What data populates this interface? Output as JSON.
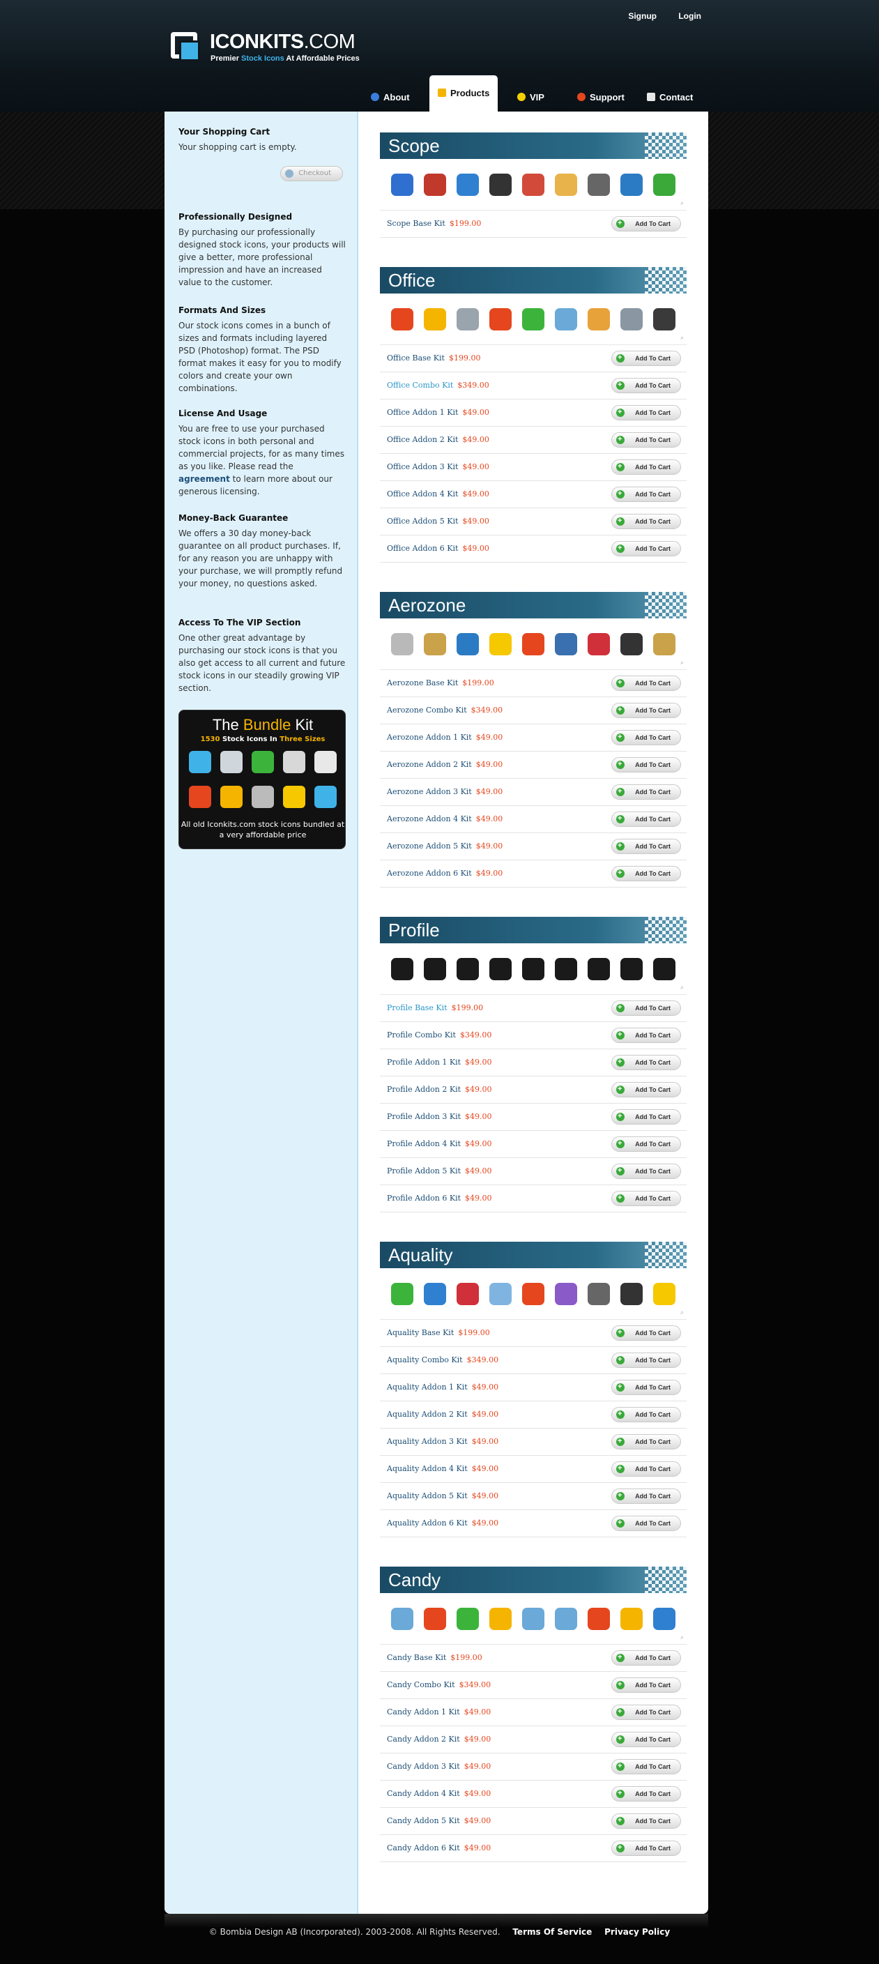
{
  "header": {
    "logo_bold": "ICONKITS",
    "logo_suffix": ".COM",
    "tagline_a": "Premier ",
    "tagline_b": "Stock Icons",
    "tagline_c": " At Affordable Prices",
    "signup": "Signup",
    "login": "Login"
  },
  "nav": [
    {
      "label": "About",
      "icon": "info-icon",
      "color": "#3b7ddd"
    },
    {
      "label": "Products",
      "icon": "box-icon",
      "color": "#f5b400"
    },
    {
      "label": "VIP",
      "icon": "lightbulb-icon",
      "color": "#f5d000"
    },
    {
      "label": "Support",
      "icon": "lifebuoy-icon",
      "color": "#e5461e"
    },
    {
      "label": "Contact",
      "icon": "mail-icon",
      "color": "#e8e8e8"
    }
  ],
  "sidebar": {
    "cart_title": "Your Shopping Cart",
    "cart_text": "Your shopping cart is empty.",
    "checkout": "Checkout",
    "blocks": [
      {
        "title": "Professionally Designed",
        "text": "By purchasing our professionally designed stock icons, your products will give a better, more professional impression and have an increased value to the customer."
      },
      {
        "title": "Formats And Sizes",
        "text": "Our stock icons comes in a bunch of sizes and formats including layered PSD (Photoshop) format. The PSD format makes it easy for you to modify colors and create your own combinations."
      },
      {
        "title": "License And Usage",
        "text_a": "You are free to use your purchased stock icons in both personal and commercial projects, for as many times as you like. Please read the ",
        "link": "agreement",
        "text_b": " to learn more about our generous licensing."
      },
      {
        "title": "Money-Back Guarantee",
        "text": "We offers a 30 day money-back guarantee on all product purchases. If, for any reason you are unhappy with your purchase, we will promptly refund your money, no questions asked."
      },
      {
        "title": "Access To The VIP Section",
        "text": "One other great advantage by purchasing our stock icons is that you also get access to all current and future stock icons in our steadily growing VIP section."
      }
    ],
    "bundle": {
      "title_a": "The ",
      "title_b": "Bundle",
      "title_c": " Kit",
      "sub_a": "1530",
      "sub_b": " Stock Icons In ",
      "sub_c": "Three Sizes",
      "foot": "All old Iconkits.com stock icons bundled at a very affordable price",
      "icons": [
        "refresh-icon",
        "calculator-icon",
        "arrow-left-icon",
        "document-icon",
        "card-icon",
        "forbidden-icon",
        "folder-icon",
        "contrast-icon",
        "grid-icon",
        "music-note-icon"
      ],
      "icon_colors": [
        "#3fb3e8",
        "#cfd6dc",
        "#3cb43c",
        "#d8d8d8",
        "#e8e8e8",
        "#e5461e",
        "#f5b400",
        "#bbbbbb",
        "#f5c800",
        "#3fb3e8"
      ]
    }
  },
  "add_label": "Add To Cart",
  "sections": [
    {
      "title": "Scope",
      "icons": [
        "info-icon",
        "user-icon",
        "refresh-icon",
        "floppy-disk-icon",
        "clock-icon",
        "envelope-icon",
        "magnifier-icon",
        "globe-icon",
        "arrow-redo-icon"
      ],
      "icon_colors": [
        "#2f6fd0",
        "#c0392b",
        "#2f80d0",
        "#333333",
        "#d24b3a",
        "#e8b34a",
        "#666666",
        "#2b7bc4",
        "#3aa93a"
      ],
      "kits": [
        {
          "name": "Scope Base Kit",
          "price": "$199.00"
        }
      ]
    },
    {
      "title": "Office",
      "icons": [
        "close-icon",
        "envelope-icon",
        "calculator-icon",
        "stop-icon",
        "arrow-left-icon",
        "folder-icon",
        "user-icon",
        "calendar-icon",
        "floppy-disk-icon"
      ],
      "icon_colors": [
        "#e5461e",
        "#f5b400",
        "#9aa4ad",
        "#e5461e",
        "#3cb43c",
        "#6aa9d8",
        "#e8a23a",
        "#8a97a3",
        "#3a3a3a"
      ],
      "kits": [
        {
          "name": "Office Base Kit",
          "price": "$199.00"
        },
        {
          "name": "Office Combo Kit",
          "price": "$349.00",
          "light": true
        },
        {
          "name": "Office Addon 1 Kit",
          "price": "$49.00"
        },
        {
          "name": "Office Addon 2 Kit",
          "price": "$49.00"
        },
        {
          "name": "Office Addon 3 Kit",
          "price": "$49.00"
        },
        {
          "name": "Office Addon 4 Kit",
          "price": "$49.00"
        },
        {
          "name": "Office Addon 5 Kit",
          "price": "$49.00"
        },
        {
          "name": "Office Addon 6 Kit",
          "price": "$49.00"
        }
      ]
    },
    {
      "title": "Aerozone",
      "icons": [
        "clock-icon",
        "document-icon",
        "globe-icon",
        "lightbulb-icon",
        "bar-chart-icon",
        "user-icon",
        "flag-icon",
        "floppy-disk-icon",
        "lock-icon"
      ],
      "icon_colors": [
        "#b9b9b9",
        "#c9a24a",
        "#2b7bc4",
        "#f5c800",
        "#e5461e",
        "#3a6fb0",
        "#d0303a",
        "#333333",
        "#c9a24a"
      ],
      "kits": [
        {
          "name": "Aerozone Base Kit",
          "price": "$199.00"
        },
        {
          "name": "Aerozone Combo Kit",
          "price": "$349.00"
        },
        {
          "name": "Aerozone Addon 1 Kit",
          "price": "$49.00"
        },
        {
          "name": "Aerozone Addon 2 Kit",
          "price": "$49.00"
        },
        {
          "name": "Aerozone Addon 3 Kit",
          "price": "$49.00"
        },
        {
          "name": "Aerozone Addon 4 Kit",
          "price": "$49.00"
        },
        {
          "name": "Aerozone Addon 5 Kit",
          "price": "$49.00"
        },
        {
          "name": "Aerozone Addon 6 Kit",
          "price": "$49.00"
        }
      ]
    },
    {
      "title": "Profile",
      "icons": [
        "pie-chart-icon",
        "close-icon",
        "users-icon",
        "clock-icon",
        "rss-icon",
        "home-icon",
        "globe-icon",
        "fast-forward-icon",
        "cart-icon"
      ],
      "icon_colors": [
        "#1a1a1a",
        "#1a1a1a",
        "#1a1a1a",
        "#1a1a1a",
        "#1a1a1a",
        "#1a1a1a",
        "#1a1a1a",
        "#1a1a1a",
        "#1a1a1a"
      ],
      "kits": [
        {
          "name": "Profile Base Kit",
          "price": "$199.00",
          "light": true
        },
        {
          "name": "Profile Combo Kit",
          "price": "$349.00"
        },
        {
          "name": "Profile Addon 1 Kit",
          "price": "$49.00"
        },
        {
          "name": "Profile Addon 2 Kit",
          "price": "$49.00"
        },
        {
          "name": "Profile Addon 3 Kit",
          "price": "$49.00"
        },
        {
          "name": "Profile Addon 4 Kit",
          "price": "$49.00"
        },
        {
          "name": "Profile Addon 5 Kit",
          "price": "$49.00"
        },
        {
          "name": "Profile Addon 6 Kit",
          "price": "$49.00"
        }
      ]
    },
    {
      "title": "Aquality",
      "icons": [
        "arrow-left-icon",
        "globe-icon",
        "flag-icon",
        "folder-icon",
        "close-icon",
        "pencil-icon",
        "printer-icon",
        "mobile-phone-icon",
        "tools-icon"
      ],
      "icon_colors": [
        "#3cb43c",
        "#2f80d0",
        "#d0303a",
        "#7fb4e0",
        "#e5461e",
        "#8a5ac8",
        "#666666",
        "#333333",
        "#f5c800"
      ],
      "kits": [
        {
          "name": "Aquality Base Kit",
          "price": "$199.00"
        },
        {
          "name": "Aquality Combo Kit",
          "price": "$349.00"
        },
        {
          "name": "Aquality Addon 1 Kit",
          "price": "$49.00"
        },
        {
          "name": "Aquality Addon 2 Kit",
          "price": "$49.00"
        },
        {
          "name": "Aquality Addon 3 Kit",
          "price": "$49.00"
        },
        {
          "name": "Aquality Addon 4 Kit",
          "price": "$49.00"
        },
        {
          "name": "Aquality Addon 5 Kit",
          "price": "$49.00"
        },
        {
          "name": "Aquality Addon 6 Kit",
          "price": "$49.00"
        }
      ]
    },
    {
      "title": "Candy",
      "icons": [
        "cd-icon",
        "stop-icon",
        "arrow-left-icon",
        "magnifier-icon",
        "speech-bubble-icon",
        "calendar-icon",
        "forbidden-icon",
        "user-icon",
        "globe-icon"
      ],
      "icon_colors": [
        "#6aa9d8",
        "#e5461e",
        "#3cb43c",
        "#f5b400",
        "#6aa9d8",
        "#6aa9d8",
        "#e5461e",
        "#f5b400",
        "#2f80d0"
      ],
      "kits": [
        {
          "name": "Candy Base Kit",
          "price": "$199.00"
        },
        {
          "name": "Candy Combo Kit",
          "price": "$349.00"
        },
        {
          "name": "Candy Addon 1 Kit",
          "price": "$49.00"
        },
        {
          "name": "Candy Addon 2 Kit",
          "price": "$49.00"
        },
        {
          "name": "Candy Addon 3 Kit",
          "price": "$49.00"
        },
        {
          "name": "Candy Addon 4 Kit",
          "price": "$49.00"
        },
        {
          "name": "Candy Addon 5 Kit",
          "price": "$49.00"
        },
        {
          "name": "Candy Addon 6 Kit",
          "price": "$49.00"
        }
      ]
    }
  ],
  "footer": {
    "copyright": "© Bombia Design AB (Incorporated). 2003-2008. All Rights Reserved.",
    "terms": "Terms Of Service",
    "privacy": "Privacy Policy"
  }
}
